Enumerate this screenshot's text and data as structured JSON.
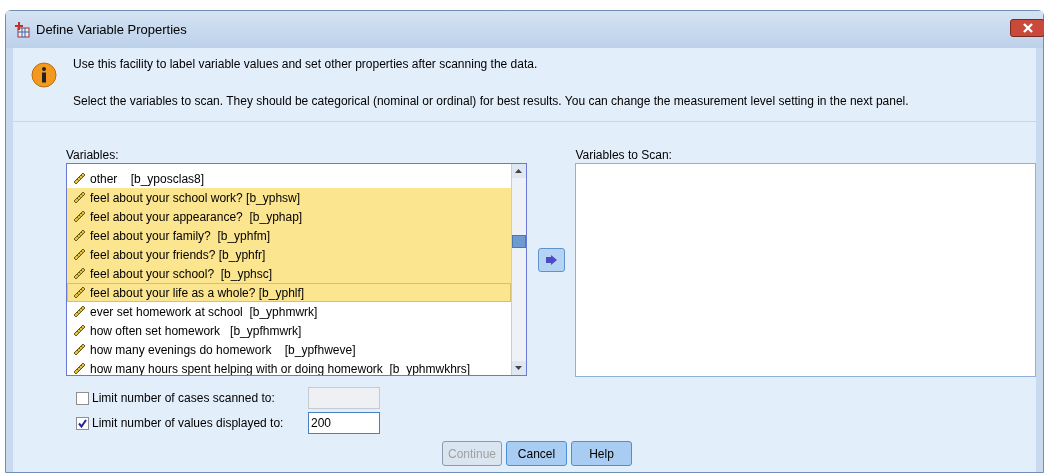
{
  "window": {
    "title": "Define Variable Properties"
  },
  "info": [
    "Use this facility to label variable values and set other properties after scanning the data.",
    "Select the variables to scan. They should be categorical (nominal or ordinal) for best results. You can change the measurement level setting in the next panel."
  ],
  "variables": {
    "label": "Variables:",
    "items": [
      {
        "text": "other    [b_yposclas8]",
        "selected": false,
        "focused": false
      },
      {
        "text": "feel about your school work? [b_yphsw]",
        "selected": true,
        "focused": false
      },
      {
        "text": "feel about your appearance?  [b_yphap]",
        "selected": true,
        "focused": false
      },
      {
        "text": "feel about your family?  [b_yphfm]",
        "selected": true,
        "focused": false
      },
      {
        "text": "feel about your friends? [b_yphfr]",
        "selected": true,
        "focused": false
      },
      {
        "text": "feel about your school?  [b_yphsc]",
        "selected": true,
        "focused": false
      },
      {
        "text": "feel about your life as a whole? [b_yphlf]",
        "selected": true,
        "focused": true
      },
      {
        "text": "ever set homework at school  [b_yphmwrk]",
        "selected": false,
        "focused": false
      },
      {
        "text": "how often set homework   [b_ypfhmwrk]",
        "selected": false,
        "focused": false
      },
      {
        "text": "how many evenings do homework    [b_ypfhweve]",
        "selected": false,
        "focused": false
      },
      {
        "text": "how many hours spent helping with or doing homework  [b_yphmwkhrs]",
        "selected": false,
        "focused": false
      }
    ]
  },
  "scan": {
    "label": "Variables to Scan:"
  },
  "options": [
    {
      "label": "Limit number of cases scanned to:",
      "checked": false
    },
    {
      "label": "Limit number of values displayed to:",
      "checked": true,
      "value": "200"
    }
  ],
  "buttons": [
    {
      "label": "Continue",
      "disabled": true
    },
    {
      "label": "Cancel",
      "disabled": false
    },
    {
      "label": "Help",
      "disabled": false
    }
  ]
}
